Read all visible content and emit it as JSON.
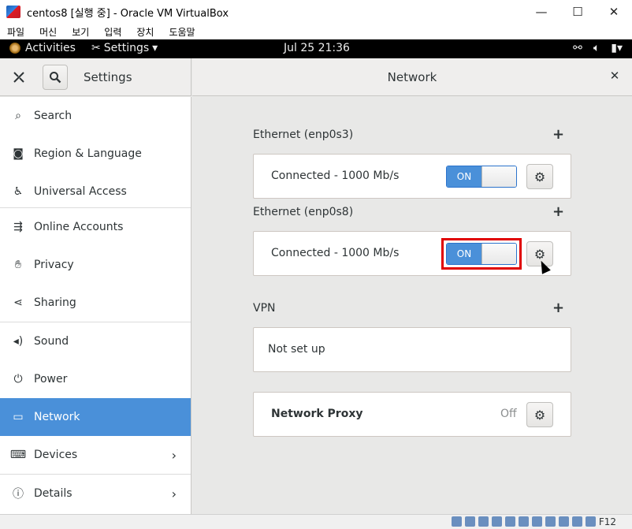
{
  "vbox": {
    "title": "centos8 [실행 중] - Oracle VM VirtualBox",
    "window_buttons": [
      "—",
      "☐",
      "✕"
    ],
    "menu": [
      "파일",
      "머신",
      "보기",
      "입력",
      "장치",
      "도움말"
    ],
    "host_key": "F12"
  },
  "topbar": {
    "activities": "Activities",
    "app_menu": "Settings",
    "clock": "Jul 25  21:36"
  },
  "header": {
    "settings_title": "Settings",
    "page_title": "Network"
  },
  "sidebar": {
    "items": [
      {
        "label": "Search",
        "icon": "search-icon"
      },
      {
        "label": "Region & Language",
        "icon": "camera-icon"
      },
      {
        "label": "Universal Access",
        "icon": "accessibility-icon"
      },
      {
        "label": "Online Accounts",
        "icon": "online-accounts-icon"
      },
      {
        "label": "Privacy",
        "icon": "hand-icon"
      },
      {
        "label": "Sharing",
        "icon": "share-icon"
      },
      {
        "label": "Sound",
        "icon": "speaker-icon"
      },
      {
        "label": "Power",
        "icon": "power-icon"
      },
      {
        "label": "Network",
        "icon": "network-icon",
        "selected": true
      },
      {
        "label": "Devices",
        "icon": "devices-icon"
      },
      {
        "label": "Details",
        "icon": "info-icon"
      }
    ]
  },
  "network": {
    "eth1": {
      "title": "Ethernet (enp0s3)",
      "status": "Connected - 1000 Mb/s",
      "toggle": "ON"
    },
    "eth2": {
      "title": "Ethernet (enp0s8)",
      "status": "Connected - 1000 Mb/s",
      "toggle": "ON"
    },
    "vpn": {
      "title": "VPN",
      "status": "Not set up"
    },
    "proxy": {
      "title": "Network Proxy",
      "status": "Off"
    }
  },
  "colors": {
    "accent": "#4a90d9",
    "highlight": "#e00000",
    "topbar": "#000000"
  }
}
